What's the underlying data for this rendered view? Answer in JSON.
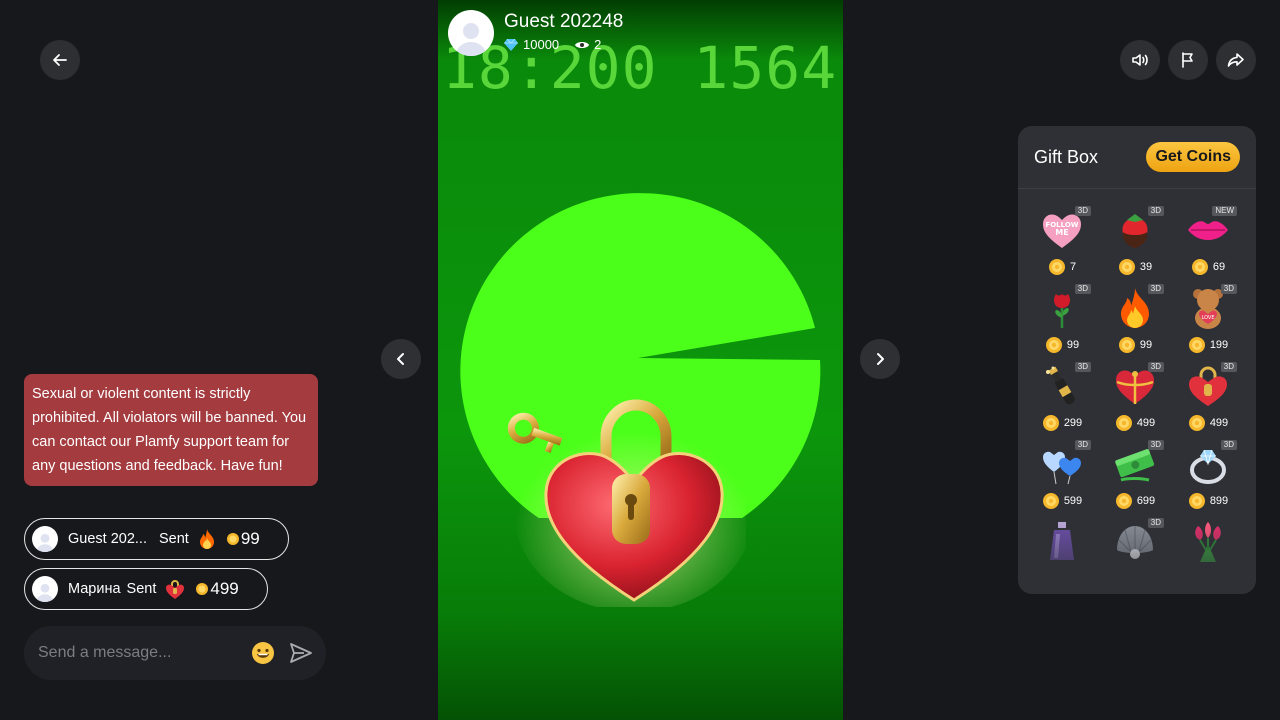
{
  "host": {
    "name": "Guest 202248",
    "diamonds": "10000",
    "viewers": "2"
  },
  "video": {
    "clock_text": "18:200 1564"
  },
  "chat": {
    "notice": "Sexual or violent content is strictly prohibited. All violators will be banned. You can contact our Plamfy support team for any questions and feedback. Have fun!",
    "gift_messages": [
      {
        "user": "Guest 202...",
        "action": "Sent",
        "gift_icon": "fire-icon",
        "amount": "99"
      },
      {
        "user": "Марина",
        "action": "Sent",
        "gift_icon": "heart-lock-icon",
        "amount": "499"
      }
    ],
    "input_placeholder": "Send a message..."
  },
  "giftbox": {
    "title": "Gift Box",
    "get_coins_label": "Get Coins",
    "gifts": [
      {
        "icon": "follow-me-heart-icon",
        "tag": "3D",
        "price": "7"
      },
      {
        "icon": "chocolate-strawberry-icon",
        "tag": "3D",
        "price": "39"
      },
      {
        "icon": "kiss-lips-icon",
        "tag": "NEW",
        "price": "69"
      },
      {
        "icon": "rose-icon",
        "tag": "3D",
        "price": "99"
      },
      {
        "icon": "fire-icon",
        "tag": "3D",
        "price": "99"
      },
      {
        "icon": "teddy-bear-icon",
        "tag": "3D",
        "price": "199"
      },
      {
        "icon": "champagne-icon",
        "tag": "3D",
        "price": "299"
      },
      {
        "icon": "heart-gift-box-icon",
        "tag": "3D",
        "price": "499"
      },
      {
        "icon": "heart-lock-icon",
        "tag": "3D",
        "price": "499"
      },
      {
        "icon": "balloon-hearts-icon",
        "tag": "3D",
        "price": "599"
      },
      {
        "icon": "money-stack-icon",
        "tag": "3D",
        "price": "699"
      },
      {
        "icon": "diamond-ring-icon",
        "tag": "3D",
        "price": "899"
      },
      {
        "icon": "perfume-icon",
        "tag": "",
        "price": ""
      },
      {
        "icon": "pearl-shell-icon",
        "tag": "3D",
        "price": ""
      },
      {
        "icon": "tulip-bouquet-icon",
        "tag": "",
        "price": ""
      }
    ]
  },
  "colors": {
    "background": "#17181b",
    "notice": "#a33b3f",
    "panel": "#2e3035",
    "coin": "#f5b72b",
    "video_green": "#4cff1a"
  }
}
